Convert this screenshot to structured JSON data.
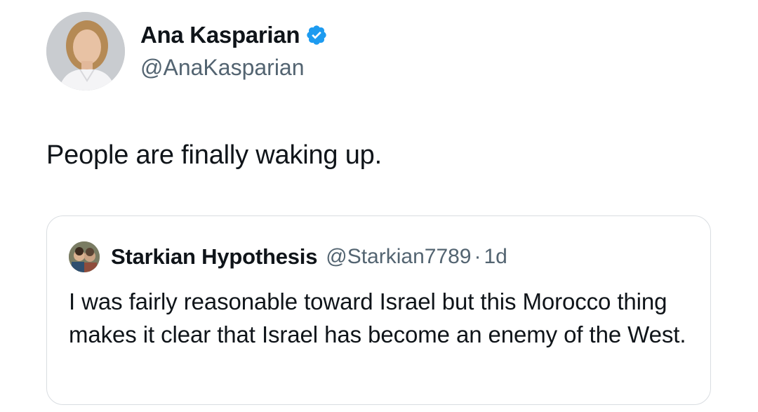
{
  "tweet": {
    "author": {
      "display_name": "Ana Kasparian",
      "handle": "@AnaKasparian",
      "verified": true,
      "verified_color": "#1d9bf0",
      "avatar_icon": "profile-photo"
    },
    "text": "People are finally waking up.",
    "quoted_tweet": {
      "author": {
        "display_name": "Starkian Hypothesis",
        "handle": "@Starkian7789",
        "avatar_icon": "profile-photo"
      },
      "separator": "·",
      "time": "1d",
      "text": "I was fairly reasonable toward Israel but this Morocco thing makes it clear that Israel has become an enemy of the West."
    }
  },
  "colors": {
    "text_primary": "#0f1419",
    "text_secondary": "#536471",
    "border": "#d9dde1",
    "background": "#ffffff"
  }
}
